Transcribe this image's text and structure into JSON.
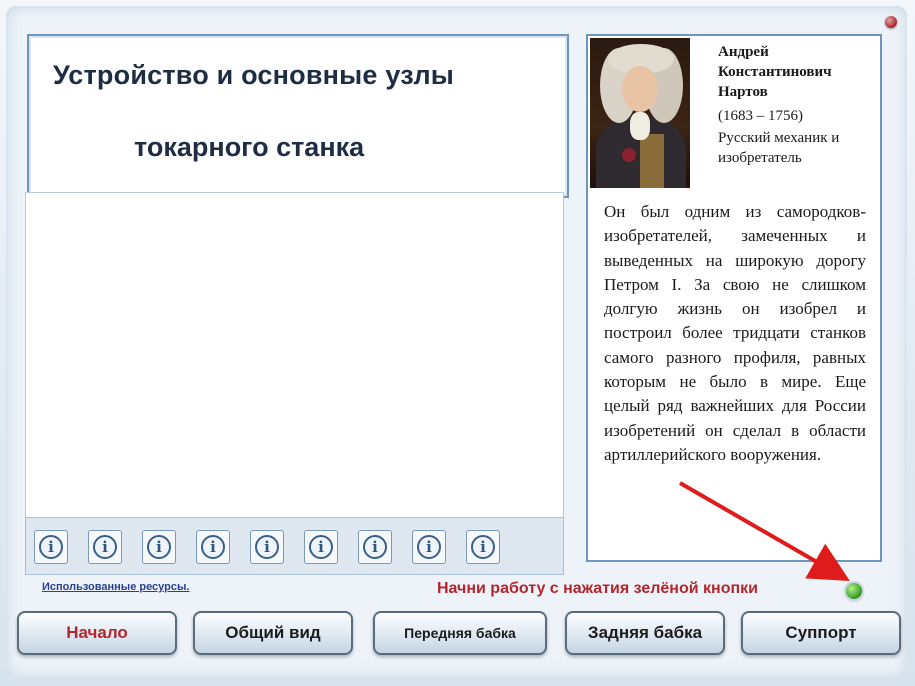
{
  "title": {
    "line1": "Устройство и основные узлы",
    "line2": "токарного станка"
  },
  "info_buttons": [
    "i",
    "i",
    "i",
    "i",
    "i",
    "i",
    "i",
    "i",
    "i"
  ],
  "bio": {
    "name": "Андрей Константинович Нартов",
    "years": "(1683 – 1756)",
    "role": "Русский механик и изобретатель",
    "text": "Он был одним из самородков-изобретателей, замеченных и выведенных на широкую дорогу Петром I. За свою не слишком долгую жизнь он изобрел и построил более тридцати станков самого разного профиля, равных которым не было в мире. Еще целый ряд важнейших для России изобретений он сделал в области артиллерийского вооружения."
  },
  "footer": {
    "resources_link": "Использованные ресурсы.",
    "start_hint": "Начни работу с нажатия зелёной кнопки"
  },
  "nav": {
    "home": "Начало",
    "overview": "Общий вид",
    "headstock": "Передняя бабка",
    "tailstock": "Задняя бабка",
    "support": "Суппорт"
  },
  "colors": {
    "accent_red": "#b3262d",
    "panel_border": "#6c95bf",
    "start_button": "#2f9a1e",
    "arrow": "#e01b1b"
  }
}
